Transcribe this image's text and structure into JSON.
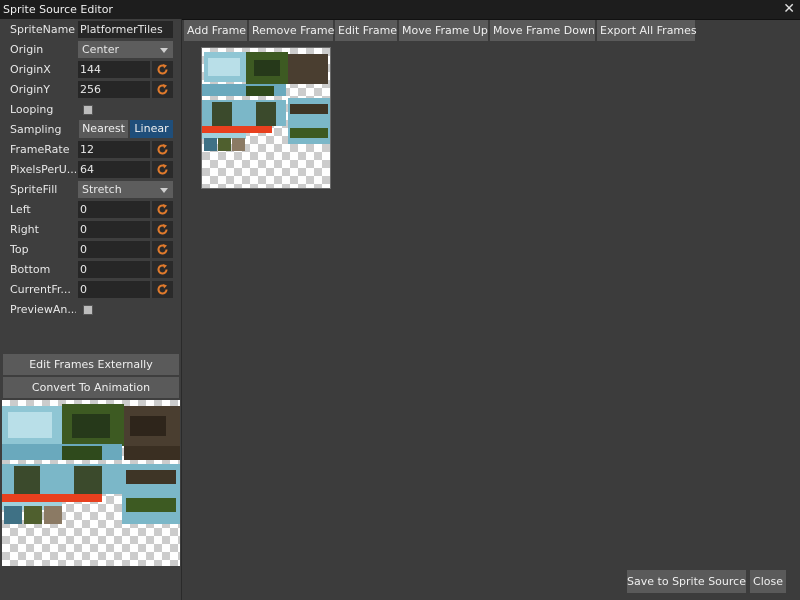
{
  "window": {
    "title": "Sprite Source Editor"
  },
  "properties": {
    "sprite_name": {
      "label": "SpriteName",
      "value": "PlatformerTiles"
    },
    "origin": {
      "label": "Origin",
      "value": "Center"
    },
    "origin_x": {
      "label": "OriginX",
      "value": "144"
    },
    "origin_y": {
      "label": "OriginY",
      "value": "256"
    },
    "looping": {
      "label": "Looping"
    },
    "sampling": {
      "label": "Sampling",
      "options": [
        "Nearest",
        "Linear"
      ],
      "selected": "Linear"
    },
    "frame_rate": {
      "label": "FrameRate",
      "value": "12"
    },
    "pixels_per_unit": {
      "label": "PixelsPerU...",
      "value": "64"
    },
    "sprite_fill": {
      "label": "SpriteFill",
      "value": "Stretch"
    },
    "left": {
      "label": "Left",
      "value": "0"
    },
    "right": {
      "label": "Right",
      "value": "0"
    },
    "top": {
      "label": "Top",
      "value": "0"
    },
    "bottom": {
      "label": "Bottom",
      "value": "0"
    },
    "current_frame": {
      "label": "CurrentFr...",
      "value": "0"
    },
    "preview_animation": {
      "label": "PreviewAn..."
    }
  },
  "side_buttons": {
    "edit_externally": "Edit Frames Externally",
    "convert": "Convert To Animation"
  },
  "toolbar": {
    "add_frame": "Add Frame",
    "remove_frame": "Remove Frame",
    "edit_frame": "Edit Frame",
    "move_up": "Move Frame Up",
    "move_down": "Move Frame Down",
    "export_all": "Export All Frames"
  },
  "footer": {
    "save": "Save to Sprite Source",
    "close": "Close"
  },
  "icons": {
    "reset": "reset-arrow-icon",
    "close": "close-icon",
    "dropdown": "chevron-down-icon"
  },
  "colors": {
    "accent": "#1f4e7a",
    "reset_icon": "#e07a2c",
    "panel": "#3e3e3e",
    "field": "#262626",
    "button": "#5a5a5a"
  }
}
